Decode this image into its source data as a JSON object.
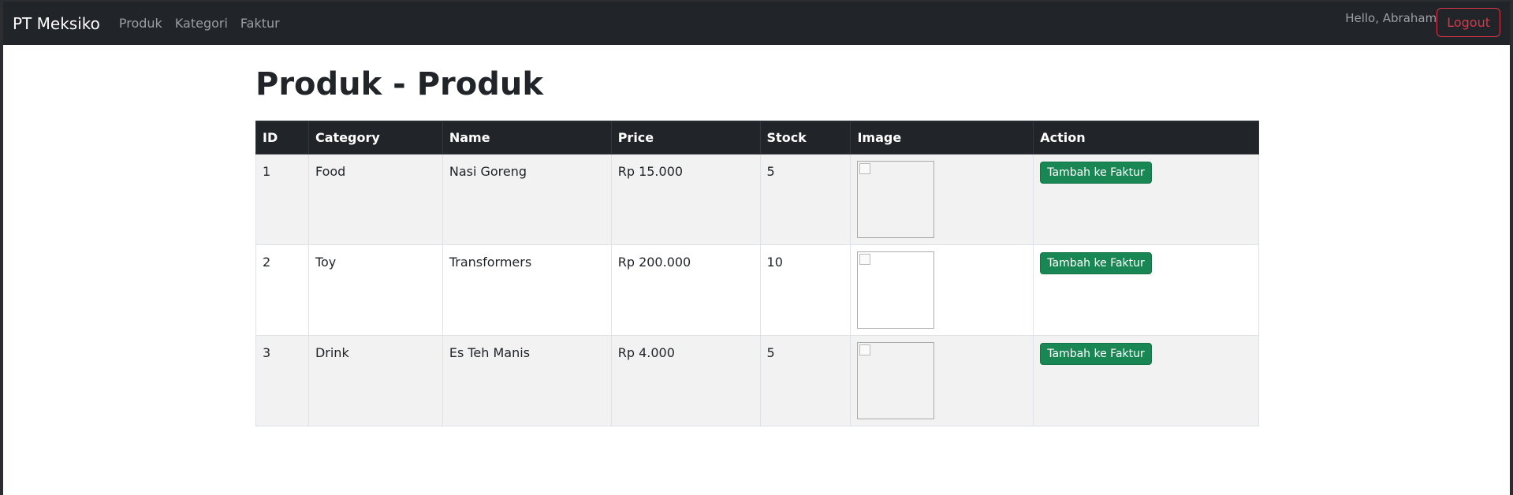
{
  "navbar": {
    "brand": "PT Meksiko",
    "links": [
      "Produk",
      "Kategori",
      "Faktur"
    ],
    "greeting": "Hello, Abraham",
    "logout_label": "Logout"
  },
  "page": {
    "title": "Produk - Produk"
  },
  "table": {
    "headers": [
      "ID",
      "Category",
      "Name",
      "Price",
      "Stock",
      "Image",
      "Action"
    ],
    "rows": [
      {
        "id": "1",
        "category": "Food",
        "name": "Nasi Goreng",
        "price": "Rp 15.000",
        "stock": "5",
        "action": "Tambah ke Faktur"
      },
      {
        "id": "2",
        "category": "Toy",
        "name": "Transformers",
        "price": "Rp 200.000",
        "stock": "10",
        "action": "Tambah ke Faktur"
      },
      {
        "id": "3",
        "category": "Drink",
        "name": "Es Teh Manis",
        "price": "Rp 4.000",
        "stock": "5",
        "action": "Tambah ke Faktur"
      }
    ]
  },
  "colors": {
    "navbar_bg": "#212529",
    "logout": "#dc3545",
    "add_button": "#198754",
    "row_striped": "#f2f2f2"
  }
}
